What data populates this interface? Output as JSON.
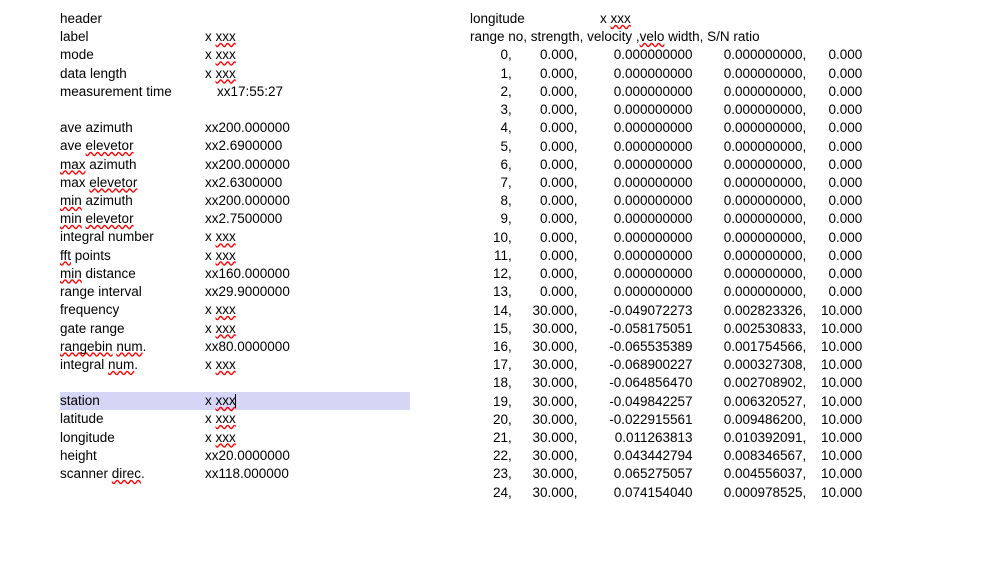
{
  "left": {
    "header_label": "header",
    "prefix": "x ",
    "xxx": "xxx",
    "xx_prefix": "xx",
    "labels": {
      "label": "label",
      "mode": "mode",
      "data_length": "data length",
      "measurement_time": "measurement time",
      "ave_azimuth": "ave azimuth",
      "ave_elevetor_pre": "ave ",
      "elevetor": "elevetor",
      "max": "max",
      "min": "min",
      "azimuth_sp": " azimuth",
      "elevetor_sp": " ",
      "integral_number": "integral number",
      "fft": "fft",
      "points": " points",
      "min_distance_pre": "min",
      "distance": " distance",
      "range_interval": "range interval",
      "frequency": "frequency",
      "gate_range": "gate range",
      "rangebin": "rangebin",
      "num": "num",
      "dot": ".",
      "integral_sp": "integral ",
      "station": "station",
      "latitude": "latitude",
      "longitude": "longitude",
      "height": "height",
      "scanner_sp": "scanner ",
      "direc": "direc"
    },
    "values": {
      "measurement_time": "17:55:27",
      "ave_azimuth": "200.000000",
      "ave_elevetor": "2.6900000",
      "max_azimuth": "200.000000",
      "max_elevetor": "2.6300000",
      "min_azimuth": "200.000000",
      "min_elevetor": "2.7500000",
      "min_distance": "160.000000",
      "range_interval": "29.9000000",
      "rangebin_num": "80.0000000",
      "height": "20.0000000",
      "scanner_direc": "118.000000"
    }
  },
  "right": {
    "longitude_label": "longitude",
    "longitude_value_prefix": "x ",
    "longitude_value": "xxx",
    "table_header": "range no, strength, velocity ,",
    "velo": "velo",
    "table_header_rest": " width, S/N ratio",
    "rows": [
      {
        "n": 0,
        "s": "0.000",
        "v": "0.000000000",
        "w": "0.000000000",
        "r": "0.000"
      },
      {
        "n": 1,
        "s": "0.000",
        "v": "0.000000000",
        "w": "0.000000000",
        "r": "0.000"
      },
      {
        "n": 2,
        "s": "0.000",
        "v": "0.000000000",
        "w": "0.000000000",
        "r": "0.000"
      },
      {
        "n": 3,
        "s": "0.000",
        "v": "0.000000000",
        "w": "0.000000000",
        "r": "0.000"
      },
      {
        "n": 4,
        "s": "0.000",
        "v": "0.000000000",
        "w": "0.000000000",
        "r": "0.000"
      },
      {
        "n": 5,
        "s": "0.000",
        "v": "0.000000000",
        "w": "0.000000000",
        "r": "0.000"
      },
      {
        "n": 6,
        "s": "0.000",
        "v": "0.000000000",
        "w": "0.000000000",
        "r": "0.000"
      },
      {
        "n": 7,
        "s": "0.000",
        "v": "0.000000000",
        "w": "0.000000000",
        "r": "0.000"
      },
      {
        "n": 8,
        "s": "0.000",
        "v": "0.000000000",
        "w": "0.000000000",
        "r": "0.000"
      },
      {
        "n": 9,
        "s": "0.000",
        "v": "0.000000000",
        "w": "0.000000000",
        "r": "0.000"
      },
      {
        "n": 10,
        "s": "0.000",
        "v": "0.000000000",
        "w": "0.000000000",
        "r": "0.000"
      },
      {
        "n": 11,
        "s": "0.000",
        "v": "0.000000000",
        "w": "0.000000000",
        "r": "0.000"
      },
      {
        "n": 12,
        "s": "0.000",
        "v": "0.000000000",
        "w": "0.000000000",
        "r": "0.000"
      },
      {
        "n": 13,
        "s": "0.000",
        "v": "0.000000000",
        "w": "0.000000000",
        "r": "0.000"
      },
      {
        "n": 14,
        "s": "30.000",
        "v": "-0.049072273",
        "w": "0.002823326",
        "r": "10.000"
      },
      {
        "n": 15,
        "s": "30.000",
        "v": "-0.058175051",
        "w": "0.002530833",
        "r": "10.000"
      },
      {
        "n": 16,
        "s": "30.000",
        "v": "-0.065535389",
        "w": "0.001754566",
        "r": "10.000"
      },
      {
        "n": 17,
        "s": "30.000",
        "v": "-0.068900227",
        "w": "0.000327308",
        "r": "10.000"
      },
      {
        "n": 18,
        "s": "30.000",
        "v": "-0.064856470",
        "w": "0.002708902",
        "r": "10.000"
      },
      {
        "n": 19,
        "s": "30.000",
        "v": "-0.049842257",
        "w": "0.006320527",
        "r": "10.000"
      },
      {
        "n": 20,
        "s": "30.000",
        "v": "-0.022915561",
        "w": "0.009486200",
        "r": "10.000"
      },
      {
        "n": 21,
        "s": "30.000",
        "v": "0.011263813",
        "w": "0.010392091",
        "r": "10.000"
      },
      {
        "n": 22,
        "s": "30.000",
        "v": "0.043442794",
        "w": "0.008346567",
        "r": "10.000"
      },
      {
        "n": 23,
        "s": "30.000",
        "v": "0.065275057",
        "w": "0.004556037",
        "r": "10.000"
      },
      {
        "n": 24,
        "s": "30.000",
        "v": "0.074154040",
        "w": "0.000978525",
        "r": "10.000"
      }
    ]
  }
}
